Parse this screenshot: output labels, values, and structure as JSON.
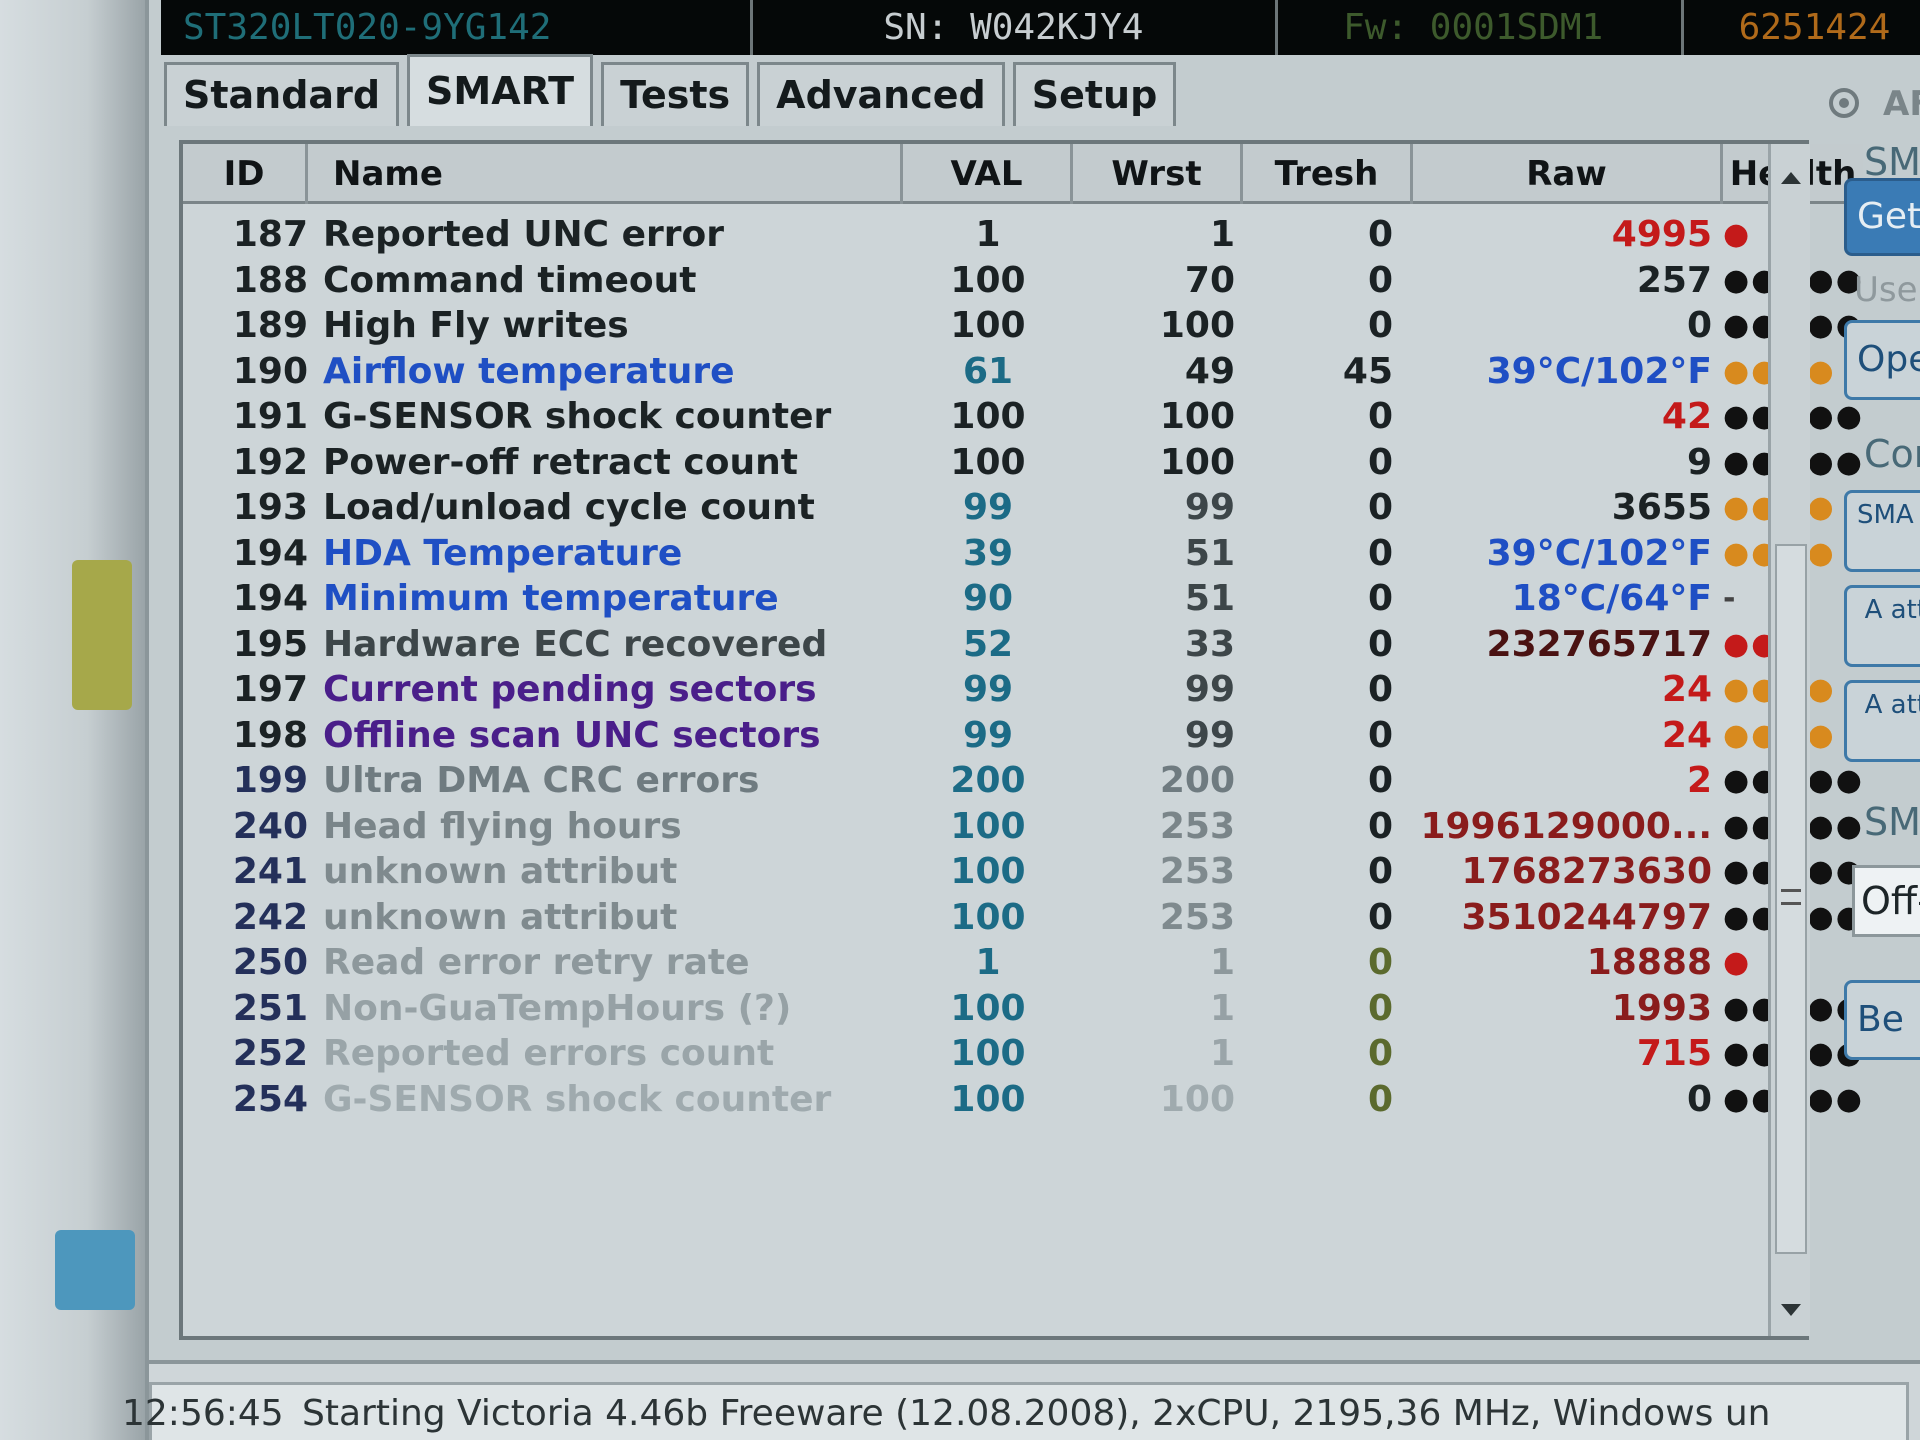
{
  "infobar": {
    "model": "ST320LT020-9YG142",
    "serial": "SN: W042KJY4",
    "firmware": "Fw: 0001SDM1",
    "lba": "6251424"
  },
  "tabs": [
    {
      "label": "Standard"
    },
    {
      "label": "SMART"
    },
    {
      "label": "Tests"
    },
    {
      "label": "Advanced"
    },
    {
      "label": "Setup"
    }
  ],
  "radio_label": "AF",
  "table": {
    "headers": {
      "id": "ID",
      "name": "Name",
      "val": "VAL",
      "wrst": "Wrst",
      "tresh": "Tresh",
      "raw": "Raw",
      "health": "Health"
    },
    "rows": [
      {
        "id": "187",
        "name": "Reported UNC error",
        "val": "1",
        "wrst": "1",
        "tresh": "0",
        "raw": "4995",
        "health": "●"
      },
      {
        "id": "188",
        "name": "Command timeout",
        "val": "100",
        "wrst": "70",
        "tresh": "0",
        "raw": "257",
        "health": "●●●●●"
      },
      {
        "id": "189",
        "name": "High Fly writes",
        "val": "100",
        "wrst": "100",
        "tresh": "0",
        "raw": "0",
        "health": "●●●●●"
      },
      {
        "id": "190",
        "name": "Airflow temperature",
        "val": "61",
        "wrst": "49",
        "tresh": "45",
        "raw": "39°C/102°F",
        "health": "●●●●"
      },
      {
        "id": "191",
        "name": "G-SENSOR shock counter",
        "val": "100",
        "wrst": "100",
        "tresh": "0",
        "raw": "42",
        "health": "●●●●●"
      },
      {
        "id": "192",
        "name": "Power-off retract count",
        "val": "100",
        "wrst": "100",
        "tresh": "0",
        "raw": "9",
        "health": "●●●●●"
      },
      {
        "id": "193",
        "name": "Load/unload cycle count",
        "val": "99",
        "wrst": "99",
        "tresh": "0",
        "raw": "3655",
        "health": "●●●●"
      },
      {
        "id": "194",
        "name": "HDA Temperature",
        "val": "39",
        "wrst": "51",
        "tresh": "0",
        "raw": "39°C/102°F",
        "health": "●●●●"
      },
      {
        "id": "194",
        "name": "Minimum temperature",
        "val": "90",
        "wrst": "51",
        "tresh": "0",
        "raw": "18°C/64°F",
        "health": "-"
      },
      {
        "id": "195",
        "name": "Hardware ECC recovered",
        "val": "52",
        "wrst": "33",
        "tresh": "0",
        "raw": "232765717",
        "health": "●●"
      },
      {
        "id": "197",
        "name": "Current pending sectors",
        "val": "99",
        "wrst": "99",
        "tresh": "0",
        "raw": "24",
        "health": "●●●●"
      },
      {
        "id": "198",
        "name": "Offline scan UNC sectors",
        "val": "99",
        "wrst": "99",
        "tresh": "0",
        "raw": "24",
        "health": "●●●●"
      },
      {
        "id": "199",
        "name": "Ultra DMA CRC errors",
        "val": "200",
        "wrst": "200",
        "tresh": "0",
        "raw": "2",
        "health": "●●●●●"
      },
      {
        "id": "240",
        "name": "Head flying hours",
        "val": "100",
        "wrst": "253",
        "tresh": "0",
        "raw": "1996129000...",
        "health": "●●●●●"
      },
      {
        "id": "241",
        "name": "unknown attribut",
        "val": "100",
        "wrst": "253",
        "tresh": "0",
        "raw": "1768273630",
        "health": "●●●●●"
      },
      {
        "id": "242",
        "name": "unknown attribut",
        "val": "100",
        "wrst": "253",
        "tresh": "0",
        "raw": "3510244797",
        "health": "●●●●●"
      },
      {
        "id": "250",
        "name": "Read error retry rate",
        "val": "1",
        "wrst": "1",
        "tresh": "0",
        "raw": "18888",
        "health": "●"
      },
      {
        "id": "251",
        "name": "Non-GuaTempHours (?)",
        "val": "100",
        "wrst": "1",
        "tresh": "0",
        "raw": "1993",
        "health": "●●●●●"
      },
      {
        "id": "252",
        "name": "Reported errors count",
        "val": "100",
        "wrst": "1",
        "tresh": "0",
        "raw": "715",
        "health": "●●●●●"
      },
      {
        "id": "254",
        "name": "G-SENSOR shock counter",
        "val": "100",
        "wrst": "100",
        "tresh": "0",
        "raw": "0",
        "health": "●●●●●"
      }
    ]
  },
  "side": {
    "group1_label": "SMA",
    "get_button": "Get",
    "use_label": "Use",
    "open_button": "Ope",
    "group2_label": "Cor",
    "smart_on_button": "SMA ON",
    "btn_a1": "A att",
    "btn_a2": "A att",
    "group3_label": "SM",
    "off_field": "Off-",
    "be_button": "Be"
  },
  "status": {
    "time": "12:56:45",
    "message": "Starting Victoria 4.46b Freeware (12.08.2008), 2xCPU, 2195,36 MHz, Windows un"
  },
  "colors": {
    "red": "#c41a1a",
    "blue": "#1f4fc4",
    "purple": "#4a1e8a",
    "teal": "#1c6b86",
    "orange": "#d88a1e"
  }
}
